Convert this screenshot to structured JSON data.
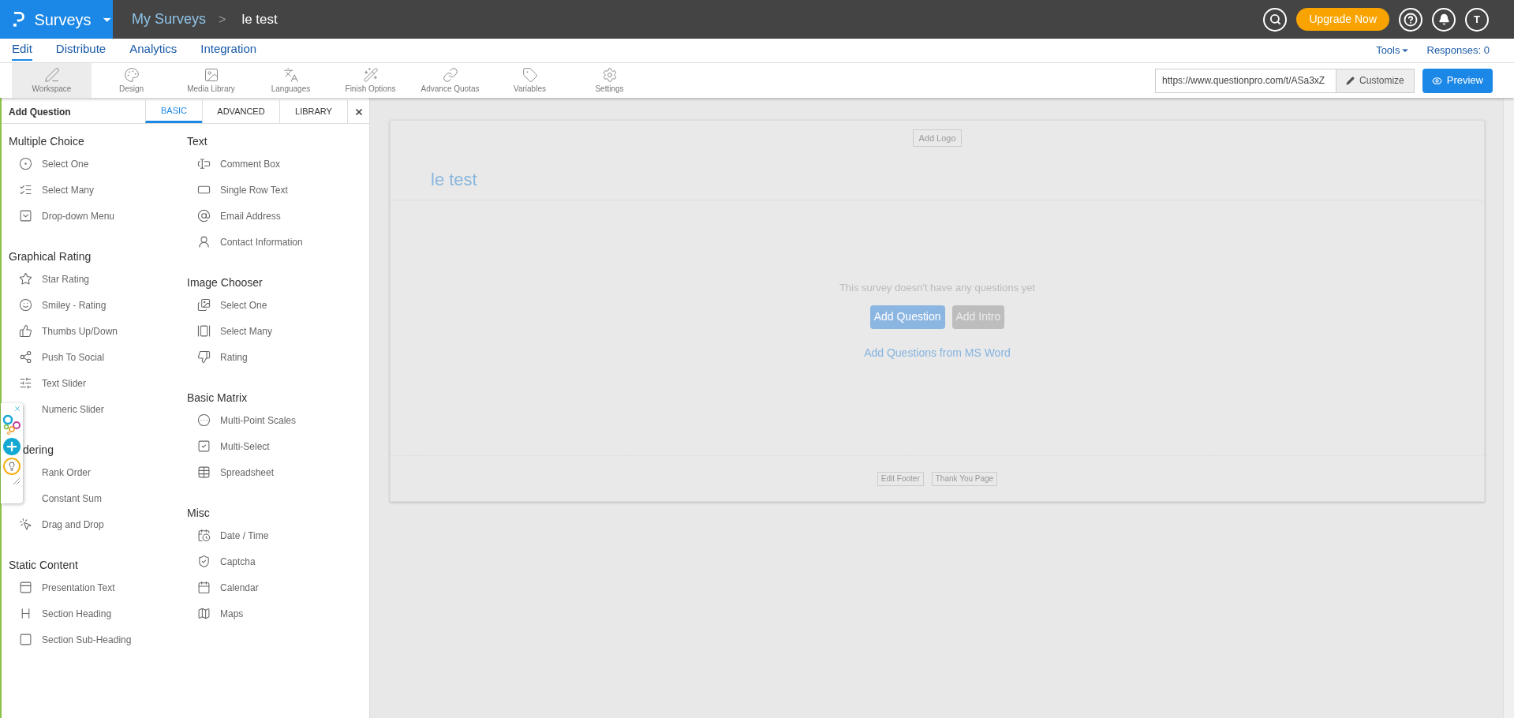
{
  "topbar": {
    "brand": "Surveys",
    "breadcrumb": "My Surveys",
    "separator": ">",
    "survey": "le test",
    "upgrade": "Upgrade Now",
    "avatar": "T"
  },
  "nav": {
    "tabs": [
      {
        "label": "Edit",
        "selected": true
      },
      {
        "label": "Distribute",
        "selected": false
      },
      {
        "label": "Analytics",
        "selected": false
      },
      {
        "label": "Integration",
        "selected": false
      }
    ],
    "tools": "Tools",
    "responses": "Responses: 0"
  },
  "toolbar": {
    "items": [
      {
        "label": "Workspace",
        "selected": true
      },
      {
        "label": "Design",
        "selected": false
      },
      {
        "label": "Media Library",
        "selected": false
      },
      {
        "label": "Languages",
        "selected": false
      },
      {
        "label": "Finish Options",
        "selected": false
      },
      {
        "label": "Advance Quotas",
        "selected": false
      },
      {
        "label": "Variables",
        "selected": false
      },
      {
        "label": "Settings",
        "selected": false
      }
    ],
    "url": "https://www.questionpro.com/t/ASa3xZ",
    "customize": "Customize",
    "preview": "Preview"
  },
  "panel": {
    "title": "Add Question",
    "tabs": [
      {
        "label": "BASIC",
        "selected": true
      },
      {
        "label": "ADVANCED",
        "selected": false
      },
      {
        "label": "LIBRARY",
        "selected": false
      }
    ],
    "columns": [
      [
        {
          "title": "Multiple Choice",
          "items": [
            "Select One",
            "Select Many",
            "Drop-down Menu"
          ]
        },
        {
          "title": "Graphical Rating",
          "items": [
            "Star Rating",
            "Smiley - Rating",
            "Thumbs Up/Down",
            "Push To Social",
            "Text Slider",
            "Numeric Slider"
          ]
        },
        {
          "title": "dering",
          "items": [
            "Rank Order",
            "Constant Sum",
            "Drag and Drop"
          ]
        },
        {
          "title": "Static Content",
          "items": [
            "Presentation Text",
            "Section Heading",
            "Section Sub-Heading"
          ]
        }
      ],
      [
        {
          "title": "Text",
          "items": [
            "Comment Box",
            "Single Row Text",
            "Email Address",
            "Contact Information"
          ]
        },
        {
          "title": "Image Chooser",
          "items": [
            "Select One",
            "Select Many",
            "Rating"
          ]
        },
        {
          "title": "Basic Matrix",
          "items": [
            "Multi-Point Scales",
            "Multi-Select",
            "Spreadsheet"
          ]
        },
        {
          "title": "Misc",
          "items": [
            "Date / Time",
            "Captcha",
            "Calendar",
            "Maps"
          ]
        }
      ]
    ]
  },
  "canvas": {
    "add_logo": "Add Logo",
    "title": "le test",
    "empty": "This survey doesn't have any questions yet",
    "add_question": "Add Question",
    "add_intro": "Add Intro",
    "import_link": "Add Questions from MS Word",
    "edit_footer": "Edit Footer",
    "thank_you": "Thank You Page"
  }
}
